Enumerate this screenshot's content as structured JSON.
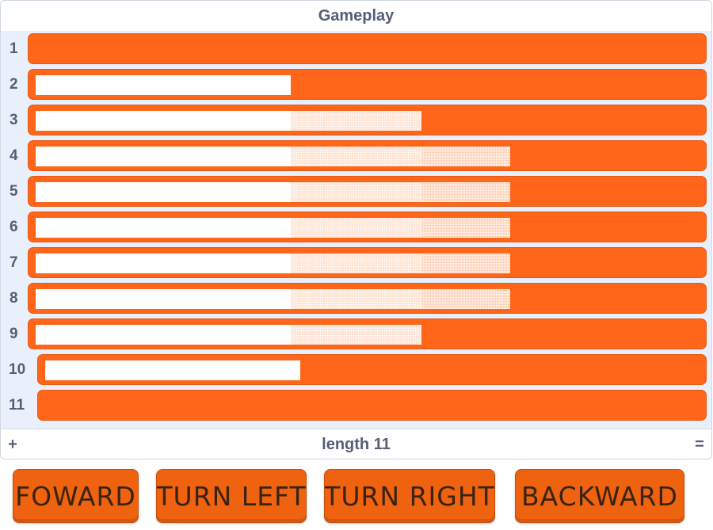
{
  "panel": {
    "title": "Gameplay",
    "add_symbol": "+",
    "length_label": "length 11",
    "resize_symbol": "="
  },
  "list_items": [
    {
      "index": "1",
      "value": ""
    },
    {
      "index": "2",
      "value": ""
    },
    {
      "index": "3",
      "value": ""
    },
    {
      "index": "4",
      "value": ""
    },
    {
      "index": "5",
      "value": ""
    },
    {
      "index": "6",
      "value": ""
    },
    {
      "index": "7",
      "value": ""
    },
    {
      "index": "8",
      "value": ""
    },
    {
      "index": "9",
      "value": ""
    },
    {
      "index": "10",
      "value": ""
    },
    {
      "index": "11",
      "value": ""
    }
  ],
  "buttons": {
    "forward": "FOWARD",
    "turn_left": "TURN LEFT",
    "turn_right": "TURN RIGHT",
    "backward": "BACKWARD"
  },
  "colors": {
    "cell": "#ff661a",
    "button": "#ee6210",
    "list_background": "#e9f0fb",
    "text": "#575e75"
  }
}
